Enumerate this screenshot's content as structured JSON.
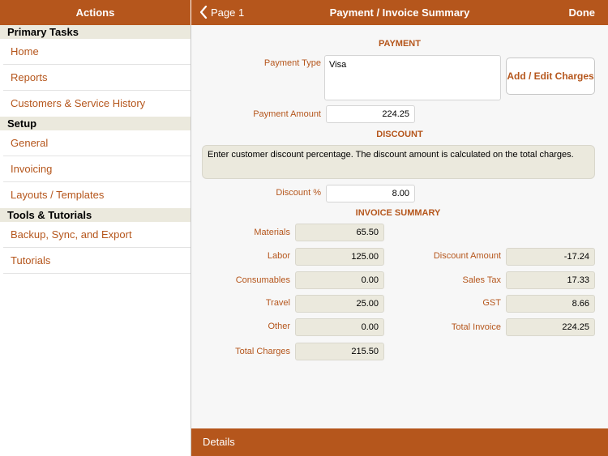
{
  "sidebar": {
    "title": "Actions",
    "sections": [
      {
        "header": "Primary Tasks",
        "items": [
          "Home",
          "Reports",
          "Customers & Service History"
        ]
      },
      {
        "header": "Setup",
        "items": [
          "General",
          "Invoicing",
          "Layouts / Templates"
        ]
      },
      {
        "header": "Tools & Tutorials",
        "items": [
          "Backup, Sync, and Export",
          "Tutorials"
        ]
      }
    ]
  },
  "header": {
    "back_label": "Page 1",
    "title": "Payment / Invoice Summary",
    "done_label": "Done"
  },
  "payment": {
    "section_title": "PAYMENT",
    "type_label": "Payment Type",
    "type_value": "Visa",
    "edit_button": "Add / Edit Charges",
    "amount_label": "Payment Amount",
    "amount_value": "224.25"
  },
  "discount": {
    "section_title": "DISCOUNT",
    "note": "Enter customer discount percentage.  The discount amount is calculated on the total charges.",
    "percent_label": "Discount %",
    "percent_value": "8.00"
  },
  "summary": {
    "section_title": "INVOICE SUMMARY",
    "materials_label": "Materials",
    "materials": "65.50",
    "labor_label": "Labor",
    "labor": "125.00",
    "consumables_label": "Consumables",
    "consumables": "0.00",
    "travel_label": "Travel",
    "travel": "25.00",
    "other_label": "Other",
    "other": "0.00",
    "total_charges_label": "Total Charges",
    "total_charges": "215.50",
    "discount_amount_label": "Discount Amount",
    "discount_amount": "-17.24",
    "sales_tax_label": "Sales Tax",
    "sales_tax": "17.33",
    "gst_label": "GST",
    "gst": "8.66",
    "total_invoice_label": "Total Invoice",
    "total_invoice": "224.25"
  },
  "footer": {
    "details_label": "Details"
  },
  "colors": {
    "accent": "#b5561c",
    "section_bg": "#ebe9dd",
    "panel_bg": "#f7f7f7"
  },
  "icons": {
    "back": "chevron-left-icon"
  }
}
